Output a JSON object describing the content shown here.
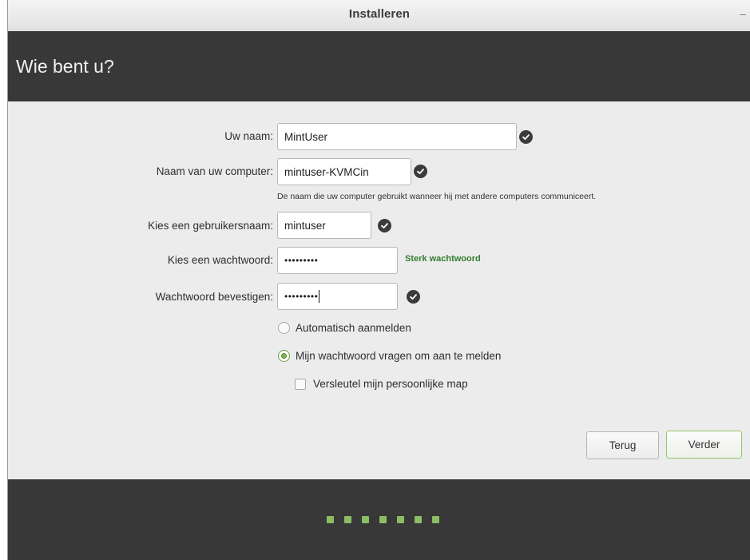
{
  "window": {
    "title": "Installeren",
    "minimize_glyph": "–"
  },
  "header": {
    "heading": "Wie bent u?"
  },
  "form": {
    "name_label": "Uw naam:",
    "name_value": "MintUser",
    "computer_label": "Naam van uw computer:",
    "computer_value": "mintuser-KVMCin",
    "computer_hint": "De naam die uw computer gebruikt wanneer hij met andere computers communiceert.",
    "username_label": "Kies een gebruikersnaam:",
    "username_value": "mintuser",
    "password_label": "Kies een wachtwoord:",
    "password_value": "•••••••••",
    "password_strength": "Sterk wachtwoord",
    "confirm_label": "Wachtwoord bevestigen:",
    "confirm_value": "•••••••••"
  },
  "options": {
    "auto_login_label": "Automatisch aanmelden",
    "auto_login_selected": false,
    "require_password_label": "Mijn wachtwoord vragen om aan te melden",
    "require_password_selected": true,
    "encrypt_home_label": "Versleutel mijn persoonlijke map",
    "encrypt_home_checked": false
  },
  "buttons": {
    "back_label": "Terug",
    "next_label": "Verder"
  },
  "progress": {
    "total_steps": 7
  },
  "icons": {
    "valid": "check-circle-icon",
    "radio": "radio-icon",
    "checkbox": "checkbox-icon"
  },
  "colors": {
    "header_bg": "#383838",
    "accent_green": "#8cbd63",
    "strength_green": "#2f7d32",
    "window_bg": "#ececec"
  }
}
